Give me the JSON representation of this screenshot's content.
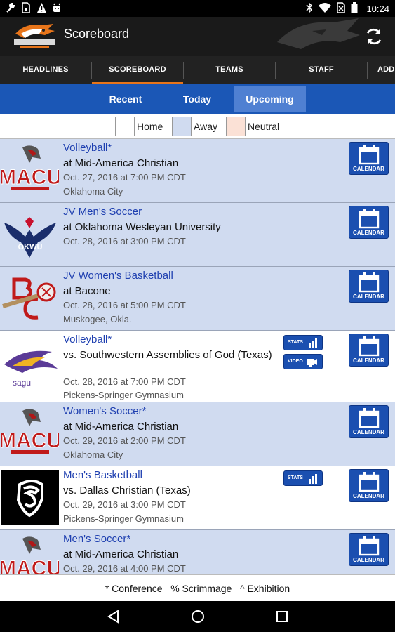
{
  "status": {
    "time": "10:24",
    "left_icons": [
      "wrench-icon",
      "sim-icon",
      "warning-icon",
      "android-icon"
    ],
    "right_icons": [
      "bluetooth-icon",
      "wifi-icon",
      "no-sim-icon",
      "battery-icon"
    ]
  },
  "app": {
    "title": "Scoreboard"
  },
  "tabs": [
    "HEADLINES",
    "SCOREBOARD",
    "TEAMS",
    "STAFF",
    "ADD"
  ],
  "active_tab": "SCOREBOARD",
  "filters": [
    "Recent",
    "Today",
    "Upcoming"
  ],
  "active_filter": "Upcoming",
  "legend": {
    "home": "Home",
    "away": "Away",
    "neutral": "Neutral",
    "colors": {
      "home": "#ffffff",
      "away": "#d0dbf0",
      "neutral": "#fbe1d6"
    }
  },
  "colors": {
    "accent": "#e8751a",
    "brand_blue": "#1b57b6",
    "link": "#1e3fb0"
  },
  "games": [
    {
      "sport": "Volleyball*",
      "opponent": "at Mid-America Christian",
      "datetime": "Oct. 27, 2016 at 7:00 PM CDT",
      "location": "Oklahoma City",
      "type": "away",
      "logo": "macu-logo"
    },
    {
      "sport": "JV Men's Soccer",
      "opponent": "at Oklahoma Wesleyan University",
      "datetime": "Oct. 28, 2016 at 3:00 PM CDT",
      "location": "",
      "type": "away",
      "logo": "okwu-logo"
    },
    {
      "sport": "JV Women's Basketball",
      "opponent": "at Bacone",
      "datetime": "Oct. 28, 2016 at 5:00 PM CDT",
      "location": "Muskogee, Okla.",
      "type": "away",
      "logo": "bacone-logo"
    },
    {
      "sport": "Volleyball*",
      "opponent": "vs. Southwestern Assemblies of God (Texas)",
      "datetime": "Oct. 28, 2016 at 7:00 PM CDT",
      "location": "Pickens-Springer Gymnasium",
      "type": "home",
      "logo": "sagu-logo"
    },
    {
      "sport": "Women's Soccer*",
      "opponent": "at Mid-America Christian",
      "datetime": "Oct. 29, 2016 at 2:00 PM CDT",
      "location": "Oklahoma City",
      "type": "away",
      "logo": "macu-logo"
    },
    {
      "sport": "Men's Basketball",
      "opponent": "vs. Dallas Christian (Texas)",
      "datetime": "Oct. 29, 2016 at 3:00 PM CDT",
      "location": "Pickens-Springer Gymnasium",
      "type": "home",
      "logo": "dallas-christian-logo"
    },
    {
      "sport": "Men's Soccer*",
      "opponent": "at Mid-America Christian",
      "datetime": "Oct. 29, 2016 at 4:00 PM CDT",
      "location": "",
      "type": "away",
      "logo": "macu-logo"
    }
  ],
  "buttons": {
    "calendar": "CALENDAR",
    "stats": "STATS",
    "video": "VIDEO"
  },
  "footer_note": "* Conference   % Scrimmage   ^ Exhibition"
}
